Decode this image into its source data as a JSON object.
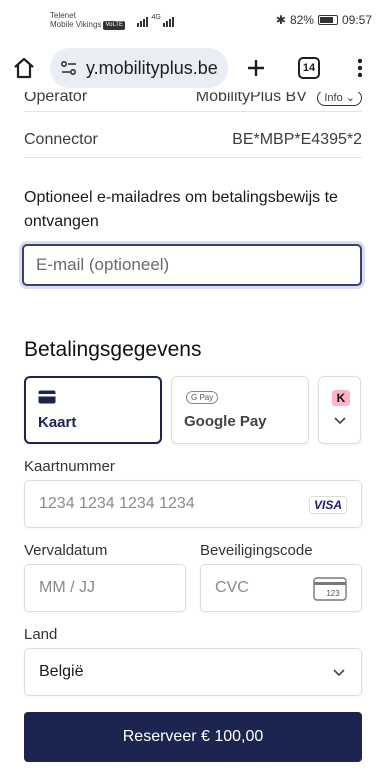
{
  "status_bar": {
    "carrier_line1": "Telenet",
    "carrier_line2": "Mobile Vikings",
    "volte": "VoLTE",
    "network": "4G",
    "battery": "82%",
    "time": "09:57"
  },
  "browser": {
    "url": "y.mobilityplus.be",
    "tab_count": "14"
  },
  "details": {
    "operator_label": "Operator",
    "operator_value": "MobilityPlus BV",
    "info_label": "Info",
    "connector_label": "Connector",
    "connector_value": "BE*MBP*E4395*2"
  },
  "email": {
    "label": "Optioneel e-mailadres om betalingsbewijs te ontvangen",
    "placeholder": "E-mail (optioneel)"
  },
  "payment": {
    "title": "Betalingsgegevens",
    "methods": [
      {
        "label": "Kaart",
        "icon": "card-icon",
        "selected": true
      },
      {
        "label": "Google Pay",
        "icon": "google-pay-icon",
        "badge": "G Pay",
        "selected": false
      },
      {
        "label": "",
        "icon": "klarna-icon",
        "badge": "K",
        "selected": false
      }
    ],
    "card_number_label": "Kaartnummer",
    "card_number_placeholder": "1234 1234 1234 1234",
    "visa_badge": "VISA",
    "expiry_label": "Vervaldatum",
    "expiry_placeholder": "MM / JJ",
    "cvc_label": "Beveiligingscode",
    "cvc_placeholder": "CVC",
    "cvc_icon_text": "123",
    "country_label": "Land",
    "country_value": "België"
  },
  "action": {
    "reserve_label": "Reserveer € 100,00"
  },
  "colors": {
    "primary": "#1b2550",
    "focus_ring": "#d9def0",
    "url_pill": "#e9eef6"
  }
}
